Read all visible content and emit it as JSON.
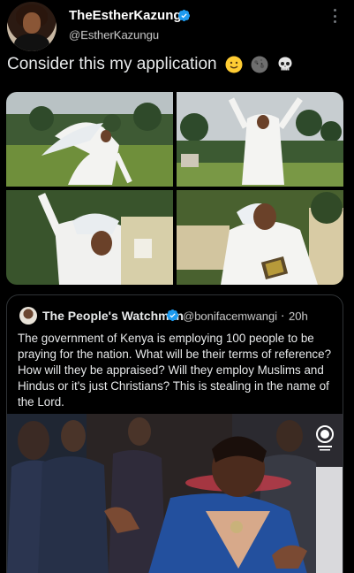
{
  "tweet": {
    "author": {
      "display_name": "TheEstherKazungu",
      "handle": "@EstherKazungu",
      "avatar_icon": "profile-photo-avatar",
      "verified_icon": "verified-badge-icon"
    },
    "text": "Consider this my application",
    "emojis": [
      "slightly-smiling-face-emoji",
      "new-moon-face-emoji",
      "skull-emoji"
    ],
    "media": {
      "count": 4,
      "tiles": [
        "photo-woman-white-robe-bowing",
        "photo-woman-white-robe-arms-raised",
        "photo-woman-white-robe-praying",
        "photo-woman-white-robe-holding-bible"
      ]
    },
    "more_icon": "more-options-icon"
  },
  "quoted_tweet": {
    "author": {
      "display_name": "The People's Watchman",
      "handle": "@bonifacemwangi",
      "verified_icon": "verified-badge-icon"
    },
    "separator": "·",
    "time": "20h",
    "text": "The government of Kenya is employing 100 people to be praying for the nation.  What will be their terms of reference? How will they be appraised? Will they employ Muslims and Hindus or it's just Christians? This is stealing in the name of the Lord.",
    "media": {
      "photo": "photo-woman-praying-with-hands-open",
      "watermark_icon": "citizen-tv-logo"
    }
  },
  "colors": {
    "background": "#000000",
    "text": "#e7e9ea",
    "verified": "#1d9bf0",
    "border": "#2f3336"
  }
}
